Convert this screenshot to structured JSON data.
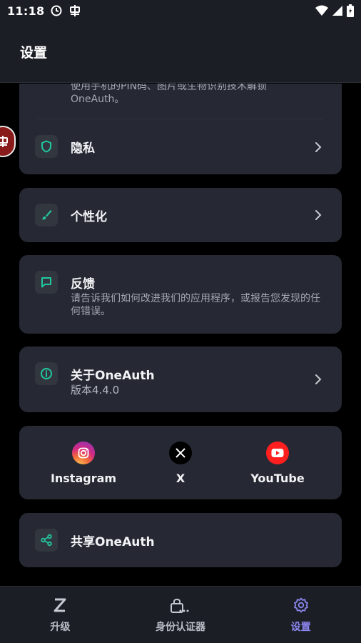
{
  "status": {
    "time": "11:18"
  },
  "header": {
    "title": "设置"
  },
  "security_card": {
    "desc": "使用手机的PIN码、图片或生物识别技术解锁OneAuth。",
    "privacy_label": "隐私"
  },
  "personalize": {
    "label": "个性化"
  },
  "feedback": {
    "title": "反馈",
    "desc": "请告诉我们如何改进我们的应用程序，或报告您发现的任何错误。"
  },
  "about": {
    "title": "关于OneAuth",
    "version": "版本4.4.0"
  },
  "social": {
    "items": [
      {
        "label": "Instagram"
      },
      {
        "label": "X"
      },
      {
        "label": "YouTube"
      }
    ]
  },
  "share": {
    "label": "共享OneAuth"
  },
  "nav": {
    "items": [
      {
        "label": "升级"
      },
      {
        "label": "身份认证器"
      },
      {
        "label": "设置"
      }
    ]
  },
  "colors": {
    "accent": "#8c86f0",
    "teal": "#22c7a0",
    "card": "#262934",
    "bar": "#1c1e26"
  }
}
